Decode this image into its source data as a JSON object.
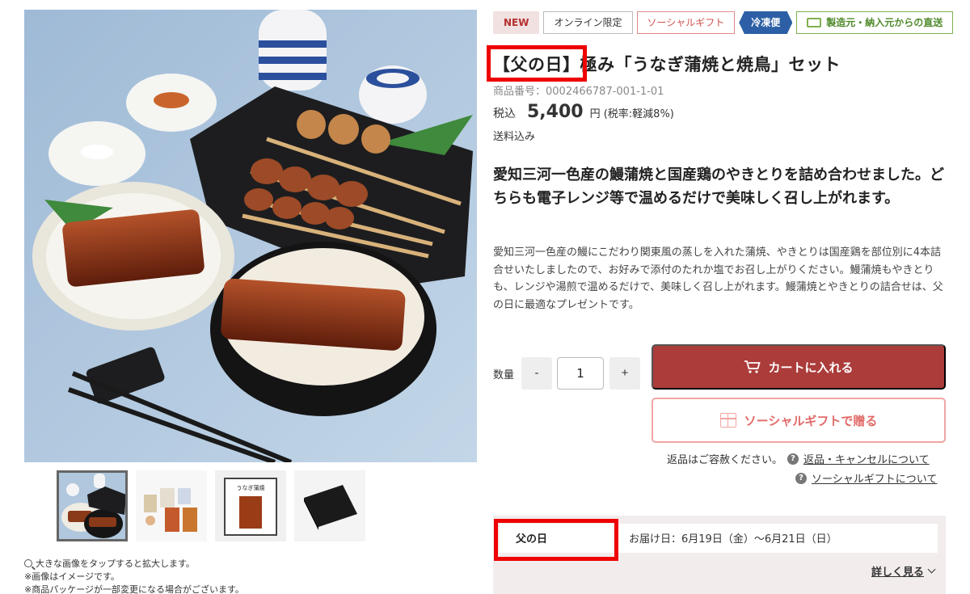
{
  "badges": {
    "new": "NEW",
    "online_only": "オンライン限定",
    "social_gift": "ソーシャルギフト",
    "frozen": "冷凍便",
    "direct_ship": "製造元・納入元からの直送"
  },
  "product": {
    "title": "【父の日】極み「うなぎ蒲焼と焼鳥」セット",
    "sku": "商品番号：0002466787-001-1-01",
    "price_prefix": "税込",
    "price": "5,400",
    "price_suffix": "円 (税率:軽減8%)",
    "shipping": "送料込み",
    "headline": "愛知三河一色産の鰻蒲焼と国産鶏のやきとりを詰め合わせました。どちらも電子レンジ等で温めるだけで美味しく召し上がれます。",
    "description": "愛知三河一色産の鰻にこだわり関東風の蒸しを入れた蒲焼、やきとりは国産鶏を部位別に4本詰合せいたしましたので、お好みで添付のたれか塩でお召し上がりください。鰻蒲焼もやきとりも、レンジや湯煎で温めるだけで、美味しく召し上がれます。鰻蒲焼とやきとりの詰合せは、父の日に最適なプレゼントです。"
  },
  "image_notes": {
    "line1": "大きな画像をタップすると拡大します。",
    "line2": "※画像はイメージです。",
    "line3": "※商品パッケージが一部変更になる場合がございます。"
  },
  "purchase": {
    "qty_label": "数量",
    "minus": "-",
    "plus": "+",
    "qty_value": "1",
    "cart_label": "カートに入れる",
    "gift_label": "ソーシャルギフトで贈る"
  },
  "links": {
    "returns_note": "返品はご容赦ください。",
    "returns_link": "返品・キャンセルについて",
    "social_link": "ソーシャルギフトについて",
    "help_glyph": "?"
  },
  "event": {
    "name": "父の日",
    "delivery": "お届け日：6月19日（金）〜6月21日（日）",
    "more": "詳しく見る"
  },
  "thumbnail_3": {
    "label": "うなぎ蒲焼"
  },
  "colors": {
    "accent": "#ab3c3a",
    "gift_pink": "#f0a5a3",
    "frozen_blue": "#2c5fa5",
    "direct_green": "#7fb04f",
    "highlight_red": "#ee0000"
  }
}
